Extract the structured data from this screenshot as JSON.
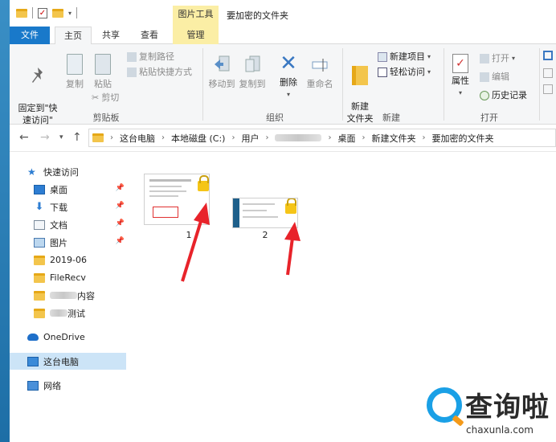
{
  "window": {
    "title": "要加密的文件夹",
    "context_tab_group": "图片工具"
  },
  "tabs": {
    "file": "文件",
    "home": "主页",
    "share": "共享",
    "view": "查看",
    "manage": "管理"
  },
  "ribbon": {
    "clipboard": {
      "label": "剪贴板",
      "pin_quick_access": "固定到\"快\n速访问\"",
      "copy": "复制",
      "paste": "粘贴",
      "copy_path": "复制路径",
      "paste_shortcut": "粘贴快捷方式",
      "cut": "剪切"
    },
    "organize": {
      "label": "组织",
      "move_to": "移动到",
      "copy_to": "复制到",
      "delete": "删除",
      "rename": "重命名"
    },
    "new": {
      "label": "新建",
      "new_folder": "新建\n文件夹",
      "new_item": "新建项目",
      "easy_access": "轻松访问"
    },
    "open": {
      "label": "打开",
      "properties": "属性",
      "open": "打开",
      "edit": "编辑",
      "history": "历史记录"
    }
  },
  "address": {
    "segments": [
      "这台电脑",
      "本地磁盘 (C:)",
      "用户",
      "",
      "桌面",
      "新建文件夹",
      "要加密的文件夹"
    ]
  },
  "navpane": {
    "quick_access": "快速访问",
    "items": [
      {
        "label": "桌面",
        "pinned": true
      },
      {
        "label": "下载",
        "pinned": true
      },
      {
        "label": "文档",
        "pinned": true
      },
      {
        "label": "图片",
        "pinned": true
      },
      {
        "label": "2019-06",
        "pinned": false
      },
      {
        "label": "FileRecv",
        "pinned": false
      },
      {
        "label": "内容",
        "pinned": false
      },
      {
        "label": "测试",
        "pinned": false
      }
    ],
    "onedrive": "OneDrive",
    "this_pc": "这台电脑",
    "network": "网络"
  },
  "files": [
    {
      "name": "1"
    },
    {
      "name": "2"
    }
  ],
  "watermark": {
    "brand": "查询啦",
    "url": "chaxunla.com"
  },
  "colors": {
    "file_tab": "#1979ca",
    "context_tab": "#fbeea5",
    "selection": "#cce4f7",
    "annotation_arrow": "#e8232a"
  }
}
